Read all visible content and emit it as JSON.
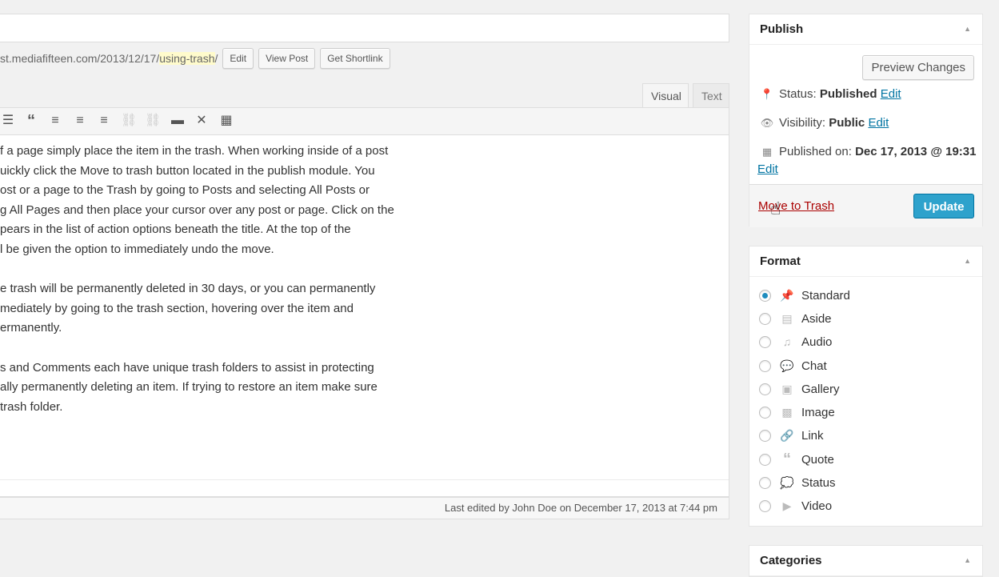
{
  "permalink": {
    "base": "st.mediafifteen.com/2013/12/17/",
    "slug": "using-trash",
    "trailing_slash": "/",
    "buttons": [
      "Edit",
      "View Post",
      "Get Shortlink"
    ]
  },
  "editor": {
    "tabs": [
      "Visual",
      "Text"
    ],
    "paragraphs": [
      [
        "f a page simply place the item in the trash. When working inside of a post",
        "uickly click the Move to trash button located in the publish module. You",
        "ost or a page to the Trash by going to Posts and selecting All Posts or",
        "g All Pages and then place your cursor over any post or page. Click on the",
        "pears in the list of action options beneath the title. At the top of the",
        "l be given the option to immediately undo the move."
      ],
      [
        "e trash will be permanently deleted in 30 days, or you can permanently",
        "mediately by going to the trash section, hovering over the item and",
        "ermanently."
      ],
      [
        "s and Comments each have unique trash folders to assist in protecting",
        "ally permanently deleting an item. If trying to restore an item make sure",
        " trash folder."
      ]
    ],
    "status_text": "Last edited by John Doe on December 17, 2013 at 7:44 pm"
  },
  "publish": {
    "title": "Publish",
    "preview_label": "Preview Changes",
    "status_label": "Status:",
    "status_value": "Published",
    "visibility_label": "Visibility:",
    "visibility_value": "Public",
    "published_label": "Published on:",
    "published_value": "Dec 17, 2013 @ 19:31",
    "edit_label": "Edit",
    "trash_label": "Move to Trash",
    "update_label": "Update"
  },
  "format": {
    "title": "Format",
    "selected": "Standard",
    "options": [
      "Standard",
      "Aside",
      "Audio",
      "Chat",
      "Gallery",
      "Image",
      "Link",
      "Quote",
      "Status",
      "Video"
    ]
  },
  "categories": {
    "title": "Categories"
  },
  "colors": {
    "accent": "#2ea2cc",
    "trash": "#aa0000",
    "link": "#0074a2"
  }
}
